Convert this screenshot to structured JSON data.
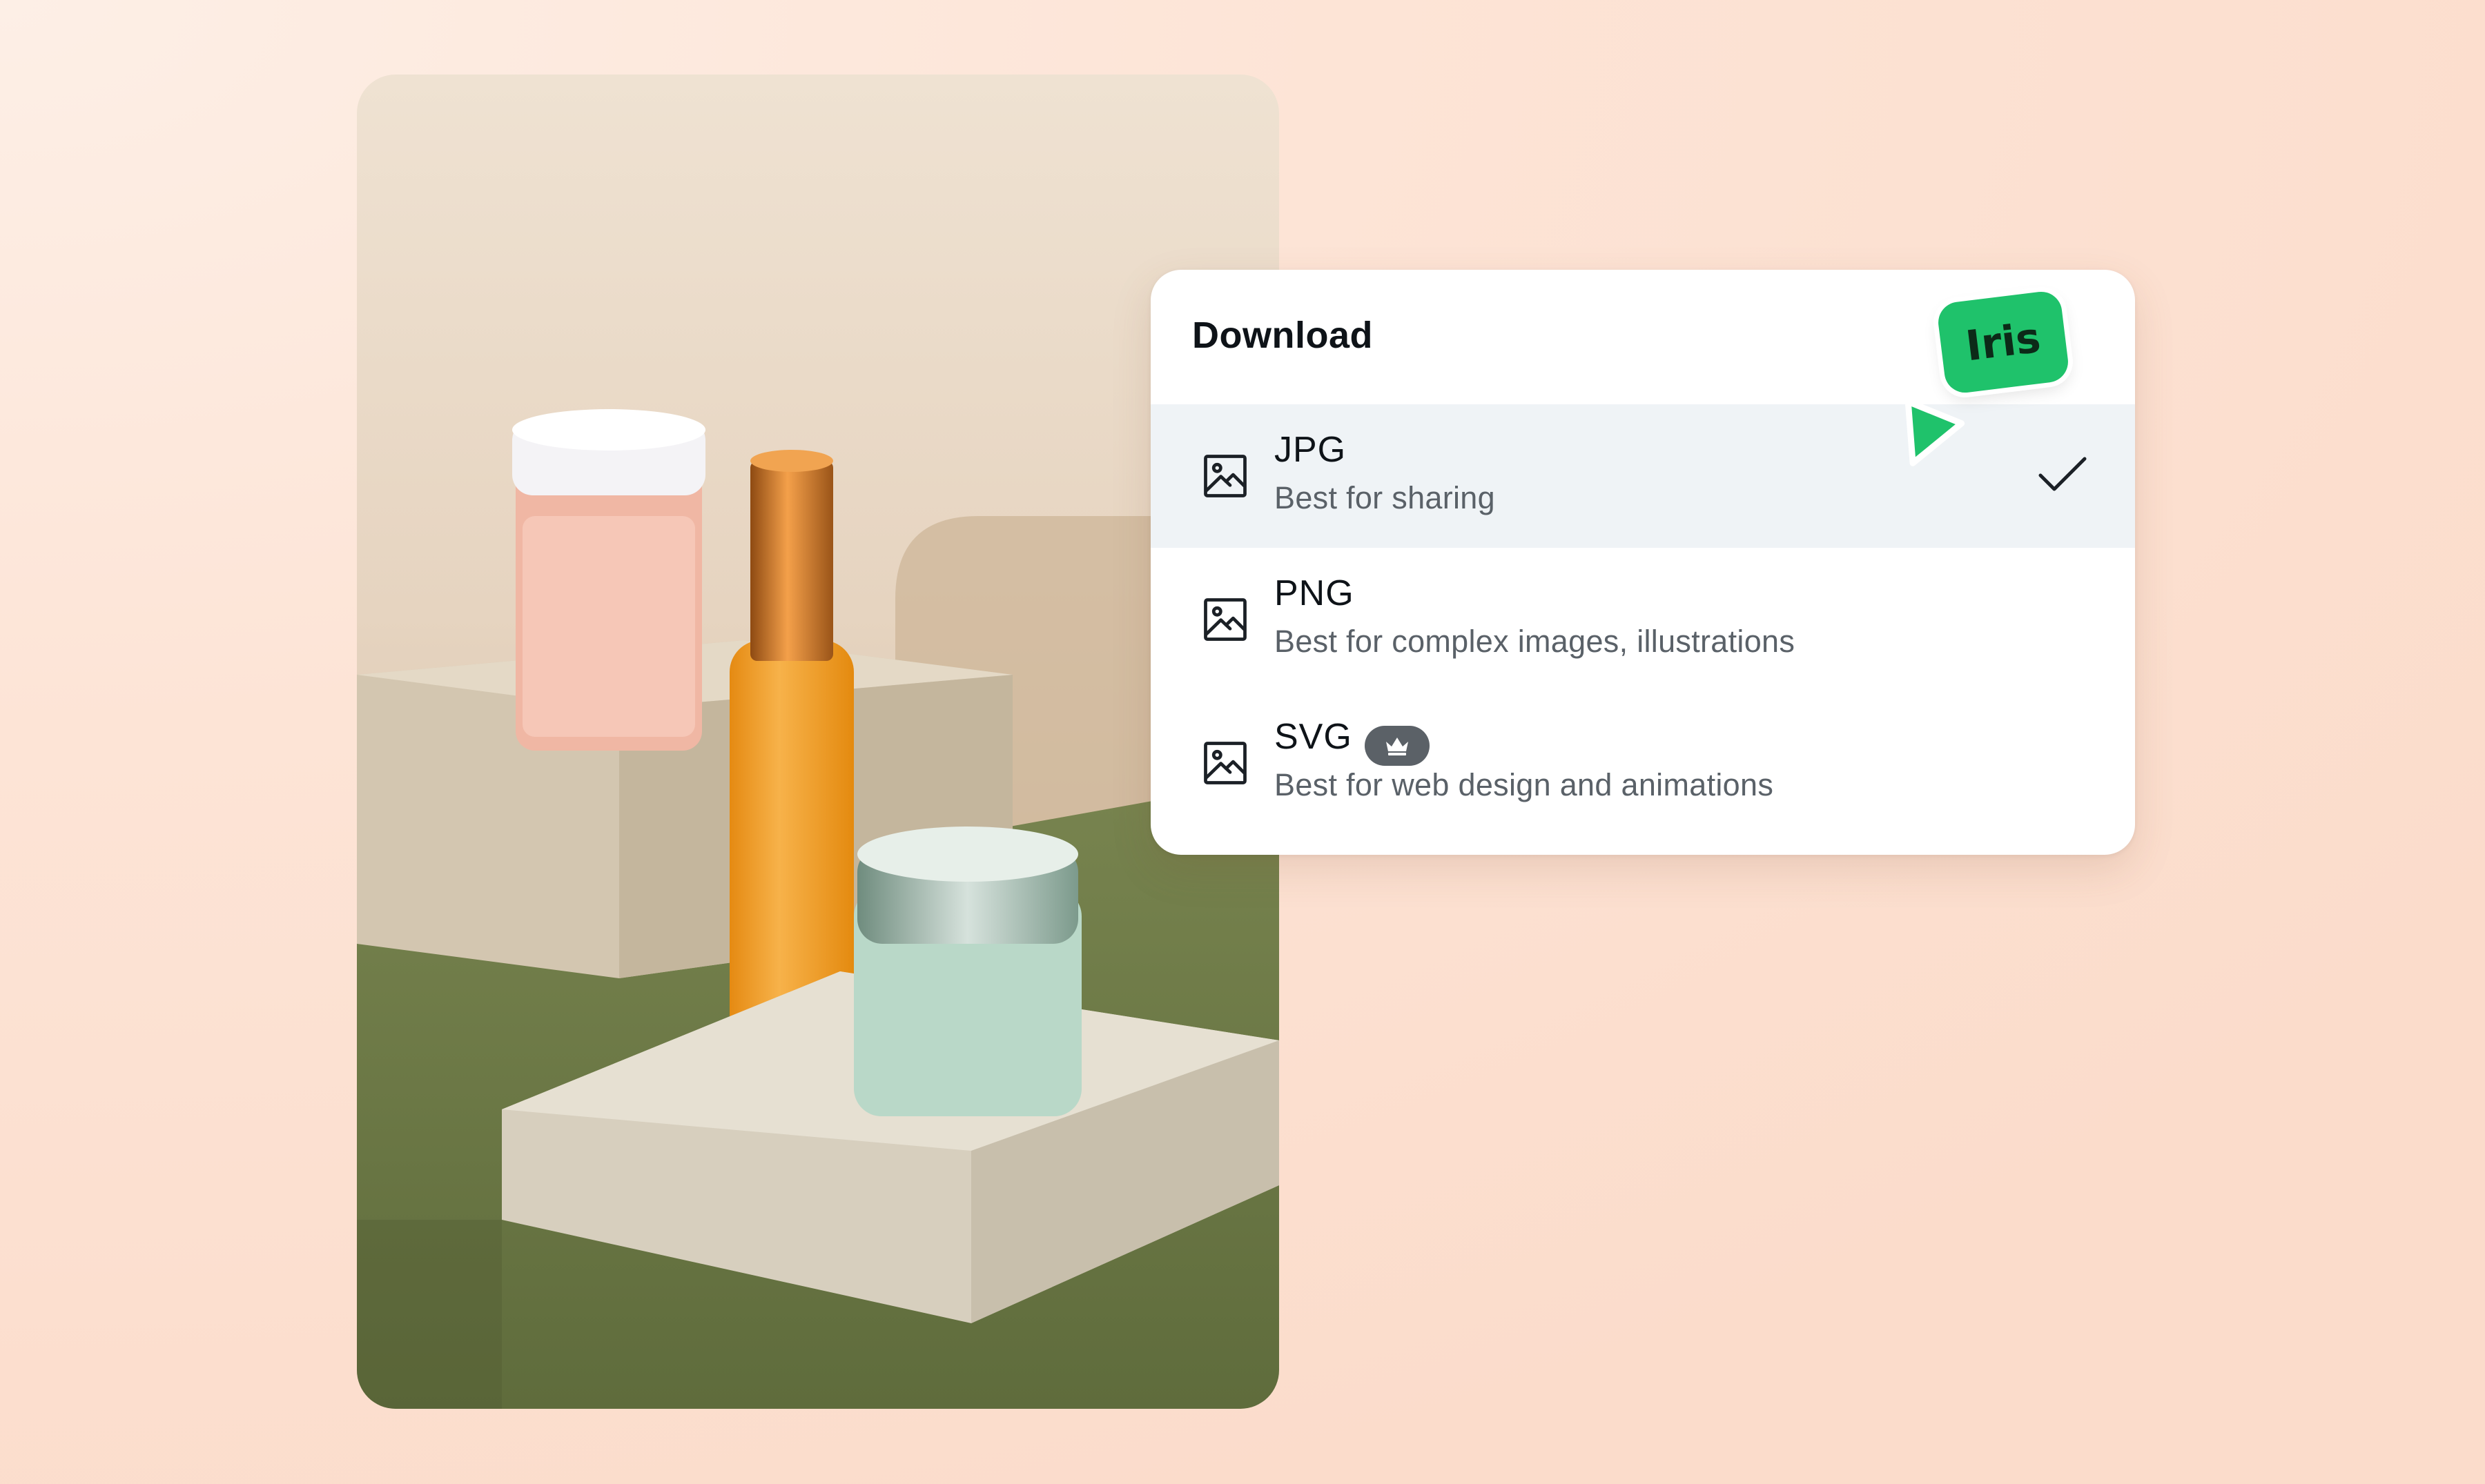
{
  "download_menu": {
    "title": "Download",
    "options": [
      {
        "name": "JPG",
        "description": "Best for sharing",
        "selected": true,
        "icon": "image-icon"
      },
      {
        "name": "PNG",
        "description": "Best for complex images, illustrations",
        "selected": false,
        "icon": "image-icon"
      },
      {
        "name": "SVG",
        "description": "Best for web design and animations",
        "selected": false,
        "icon": "image-icon",
        "badge_icon": "crown-icon"
      }
    ]
  },
  "collaborator": {
    "name": "Iris",
    "color": "#1fc26b"
  },
  "colors": {
    "background": "#fde4d6",
    "selected_row": "#eff3f6",
    "badge": "#5b6167"
  }
}
